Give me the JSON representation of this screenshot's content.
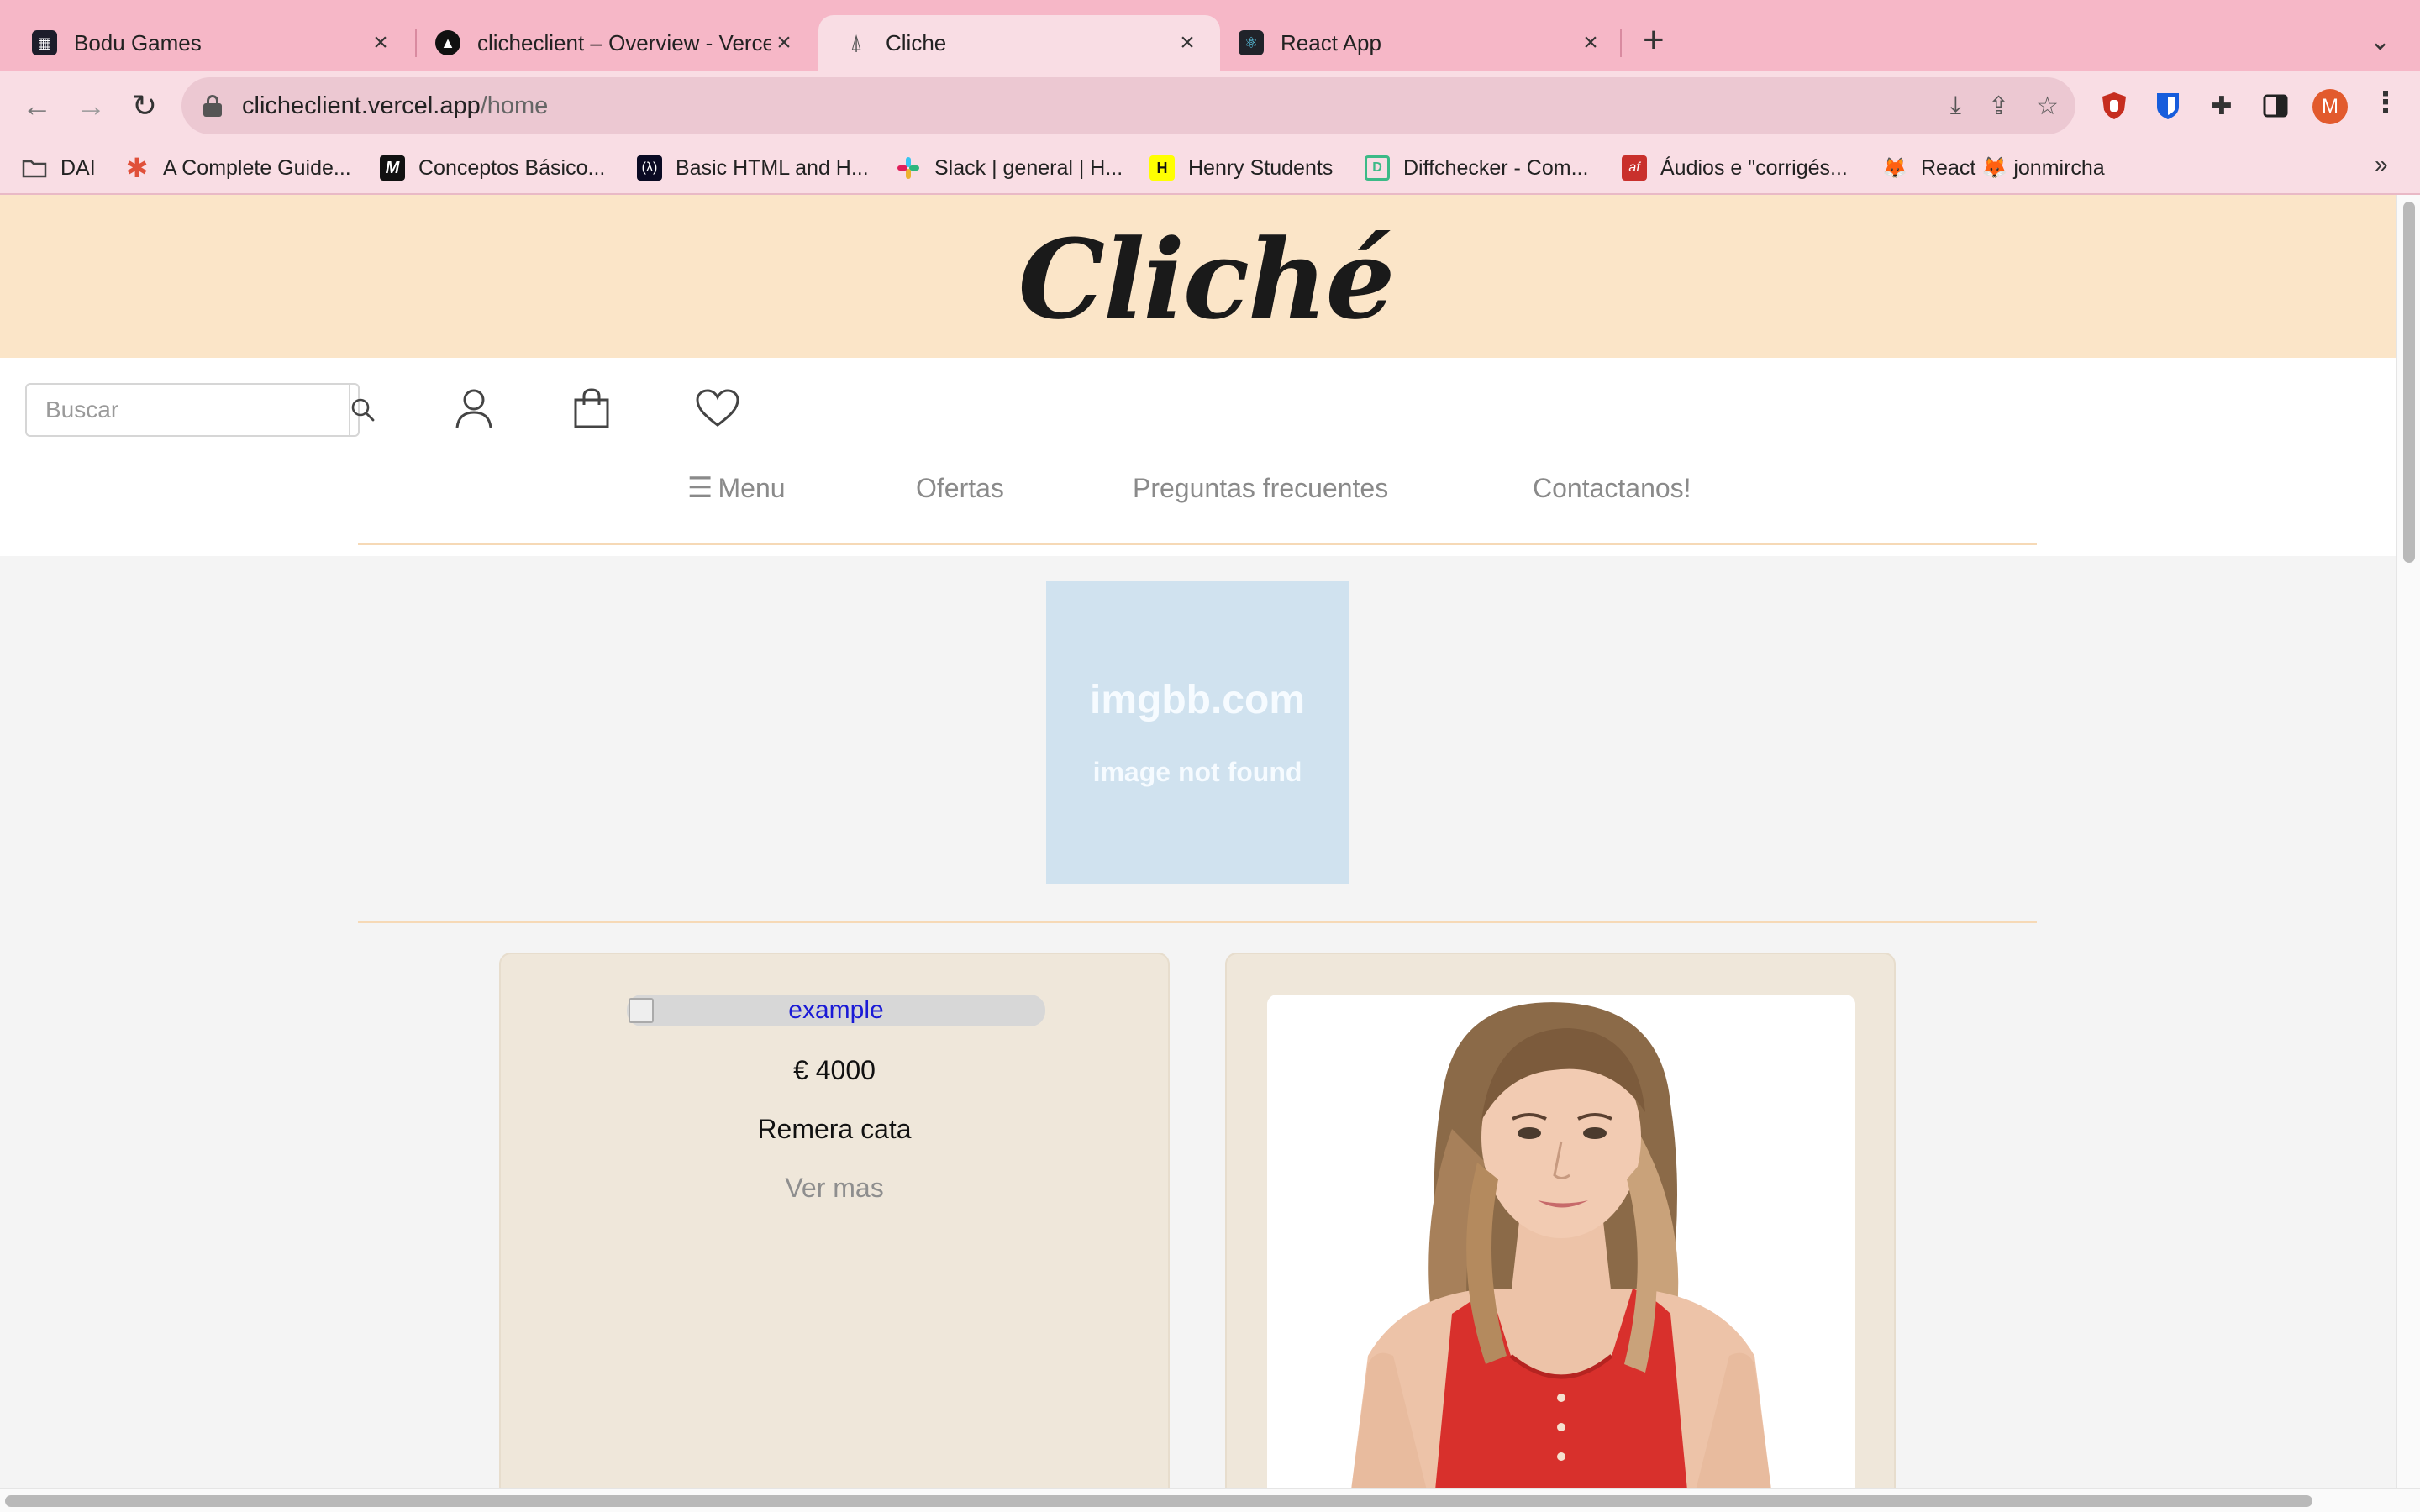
{
  "browser": {
    "tabs": [
      {
        "title": "Bodu Games",
        "icon": "bodu-games-favicon"
      },
      {
        "title": "clicheclient – Overview - Verce",
        "icon": "vercel-favicon"
      },
      {
        "title": "Cliche",
        "icon": "cliche-favicon"
      },
      {
        "title": "React App",
        "icon": "react-favicon"
      }
    ],
    "new_tab_label": "+",
    "url_host": "clicheclient.vercel.app",
    "url_path": "/home",
    "profile_initial": "M",
    "bookmarks": [
      {
        "label": "DAI",
        "icon": "folder-icon"
      },
      {
        "label": "A Complete Guide...",
        "icon": "asterisk-icon"
      },
      {
        "label": "Conceptos Básico...",
        "icon": "m-logo-icon"
      },
      {
        "label": "Basic HTML and H...",
        "icon": "freecodecamp-icon"
      },
      {
        "label": "Slack | general | H...",
        "icon": "slack-icon"
      },
      {
        "label": "Henry Students",
        "icon": "henry-icon"
      },
      {
        "label": "Diffchecker - Com...",
        "icon": "diffchecker-icon"
      },
      {
        "label": "Áudios e \"corrigés...",
        "icon": "af-icon"
      },
      {
        "label": "React 🦊 jonmircha",
        "icon": "fox-icon"
      }
    ],
    "bookmarks_more": "»"
  },
  "site": {
    "logo_text": "Cliché",
    "search_placeholder": "Buscar",
    "nav": {
      "menu": "Menu",
      "ofertas": "Ofertas",
      "faq": "Preguntas frecuentes",
      "contact": "Contactanos!"
    },
    "banner": {
      "line1": "imgbb.com",
      "line2": "image not found"
    },
    "products": [
      {
        "alt": "example",
        "price": "€ 4000",
        "name": "Remera cata",
        "cta": "Ver mas"
      }
    ]
  },
  "colors": {
    "chrome_pink": "#f6b7c7",
    "hero_bg": "#fbe5c8",
    "card_bg": "#efe7da",
    "banner_bg": "#d0e2ef"
  }
}
